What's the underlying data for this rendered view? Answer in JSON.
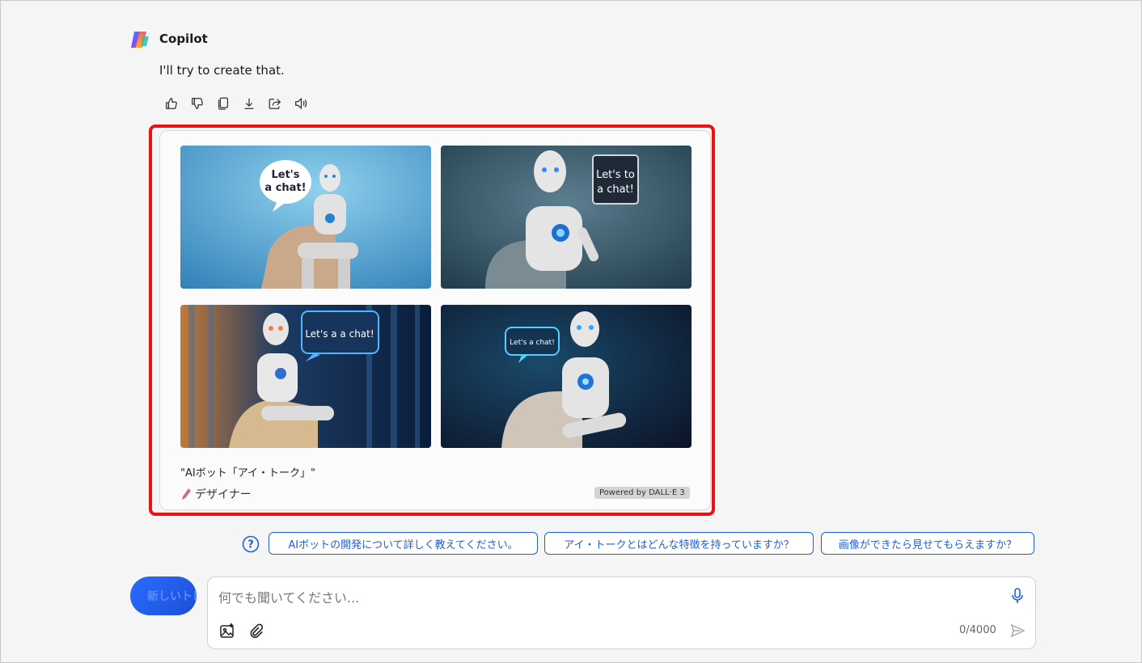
{
  "app": {
    "name": "Copilot"
  },
  "message": {
    "text": "I'll try to create that."
  },
  "actions": [
    "thumbs-up-icon",
    "thumbs-down-icon",
    "copy-icon",
    "download-icon",
    "share-icon",
    "speaker-icon"
  ],
  "images": [
    {
      "bubble": "Let's a chat!",
      "icon": "robot-image"
    },
    {
      "bubble": "Let's to a chat!",
      "icon": "robot-image"
    },
    {
      "bubble": "Let's a a chat!",
      "icon": "robot-image"
    },
    {
      "bubble": "Let's a chat!",
      "icon": "robot-image"
    }
  ],
  "card": {
    "caption": "\"AIボット「アイ・トーク」\"",
    "designer_label": "デザイナー",
    "badge": "Powered by DALL·E 3"
  },
  "suggestions": [
    "AIボットの開発について詳しく教えてください。",
    "アイ・トークとはどんな特徴を持っていますか？",
    "画像ができたら見せてもらえますか？"
  ],
  "new_chat": {
    "label": "新しいトピック"
  },
  "composer": {
    "placeholder": "何でも聞いてください...",
    "value": "",
    "counter": "0/4000"
  },
  "colors": {
    "accent": "#1f5fd6",
    "highlight": "#ee1111",
    "new_chat": "#2b6cff"
  }
}
